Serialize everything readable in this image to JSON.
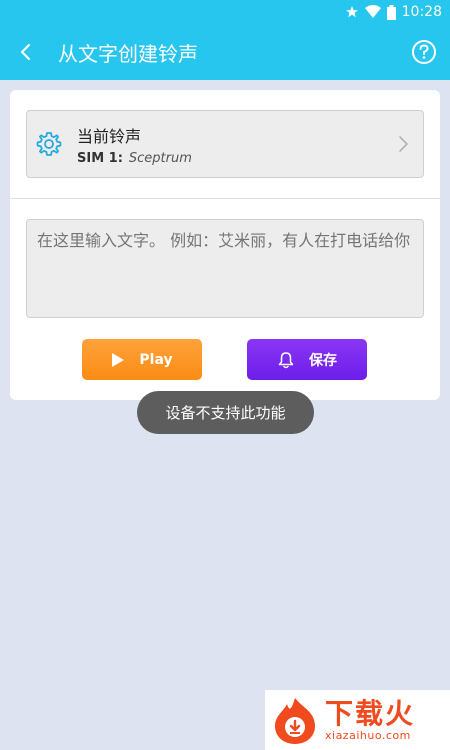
{
  "status_bar": {
    "time": "10:28",
    "icons": [
      "star-icon",
      "wifi-icon",
      "battery-icon"
    ]
  },
  "app_bar": {
    "title": "从文字创建铃声",
    "back_icon": "back-arrow-icon",
    "help_icon": "help-icon"
  },
  "current_ringtone": {
    "heading": "当前铃声",
    "sim_label": "SIM 1:",
    "ringtone_name": "Sceptrum",
    "icon": "gear-icon"
  },
  "text_input": {
    "value": "",
    "placeholder": "在这里输入文字。 例如：艾米丽，有人在打电话给你"
  },
  "buttons": {
    "play_label": "Play",
    "save_label": "保存"
  },
  "toast": {
    "message": "设备不支持此功能"
  },
  "watermark": {
    "brand": "下载火",
    "domain": "xiazaihuo.com"
  },
  "colors": {
    "primary": "#26c6ee",
    "play": "#fb8c14",
    "save": "#6c1ee8",
    "background": "#dde3f0",
    "watermark": "#f04a1f"
  }
}
